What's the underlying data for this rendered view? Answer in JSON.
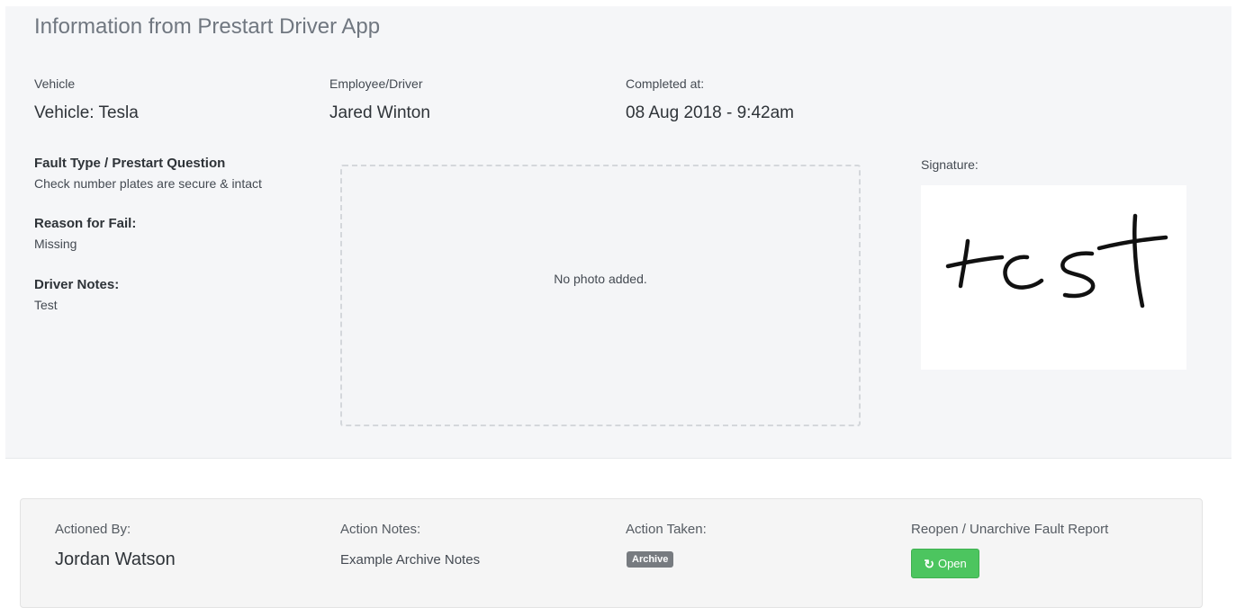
{
  "prestart": {
    "title": "Information from Prestart Driver App",
    "vehicle": {
      "label": "Vehicle",
      "value": "Vehicle: Tesla"
    },
    "driver": {
      "label": "Employee/Driver",
      "value": "Jared Winton"
    },
    "completed": {
      "label": "Completed at:",
      "value": "08 Aug 2018 - 9:42am"
    },
    "fault_type": {
      "label": "Fault Type / Prestart Question",
      "value": "Check number plates are secure & intact"
    },
    "reason": {
      "label": "Reason for Fail:",
      "value": "Missing"
    },
    "notes": {
      "label": "Driver Notes:",
      "value": "Test"
    },
    "photo_message": "No photo added.",
    "signature_label": "Signature:",
    "signature_text": "test"
  },
  "action": {
    "actioned_by": {
      "label": "Actioned By:",
      "value": "Jordan Watson"
    },
    "action_notes": {
      "label": "Action Notes:",
      "value": "Example Archive Notes"
    },
    "action_taken": {
      "label": "Action Taken:",
      "badge": "Archive"
    },
    "reopen": {
      "label": "Reopen / Unarchive Fault Report",
      "button_label": "Open"
    }
  },
  "colors": {
    "open_button": "#4cc55f",
    "archive_badge": "#777b80",
    "panel_background": "#f5f6f8"
  },
  "icons": {
    "open_button_icon": "refresh-icon"
  }
}
